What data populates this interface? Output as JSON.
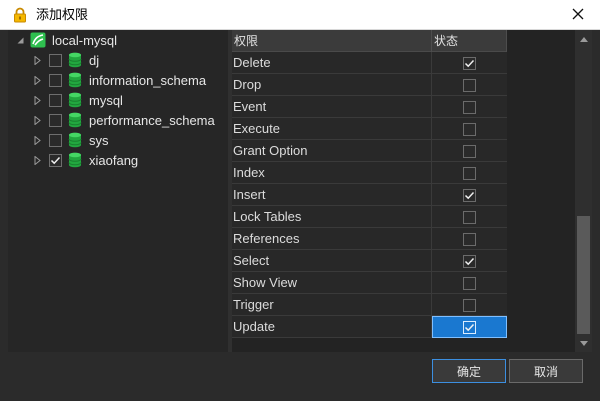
{
  "window": {
    "title": "添加权限",
    "lock_icon": "lock-icon",
    "close_icon": "close-icon"
  },
  "tree": {
    "root": {
      "label": "local-mysql",
      "icon": "connection-icon",
      "expanded": true
    },
    "databases": [
      {
        "label": "dj",
        "checked": false
      },
      {
        "label": "information_schema",
        "checked": false
      },
      {
        "label": "mysql",
        "checked": false
      },
      {
        "label": "performance_schema",
        "checked": false
      },
      {
        "label": "sys",
        "checked": false
      },
      {
        "label": "xiaofang",
        "checked": true
      }
    ]
  },
  "grid": {
    "columns": [
      "权限",
      "状态"
    ],
    "rows": [
      {
        "name": "Delete",
        "checked": true
      },
      {
        "name": "Drop",
        "checked": false
      },
      {
        "name": "Event",
        "checked": false
      },
      {
        "name": "Execute",
        "checked": false
      },
      {
        "name": "Grant Option",
        "checked": false
      },
      {
        "name": "Index",
        "checked": false
      },
      {
        "name": "Insert",
        "checked": true
      },
      {
        "name": "Lock Tables",
        "checked": false
      },
      {
        "name": "References",
        "checked": false
      },
      {
        "name": "Select",
        "checked": true
      },
      {
        "name": "Show View",
        "checked": false
      },
      {
        "name": "Trigger",
        "checked": false
      },
      {
        "name": "Update",
        "checked": true,
        "selected": true
      }
    ]
  },
  "footer": {
    "ok_label": "确定",
    "cancel_label": "取消"
  },
  "colors": {
    "accent": "#1a78d0",
    "db_icon": "#2fbf4f",
    "background": "#2b2b2b"
  }
}
